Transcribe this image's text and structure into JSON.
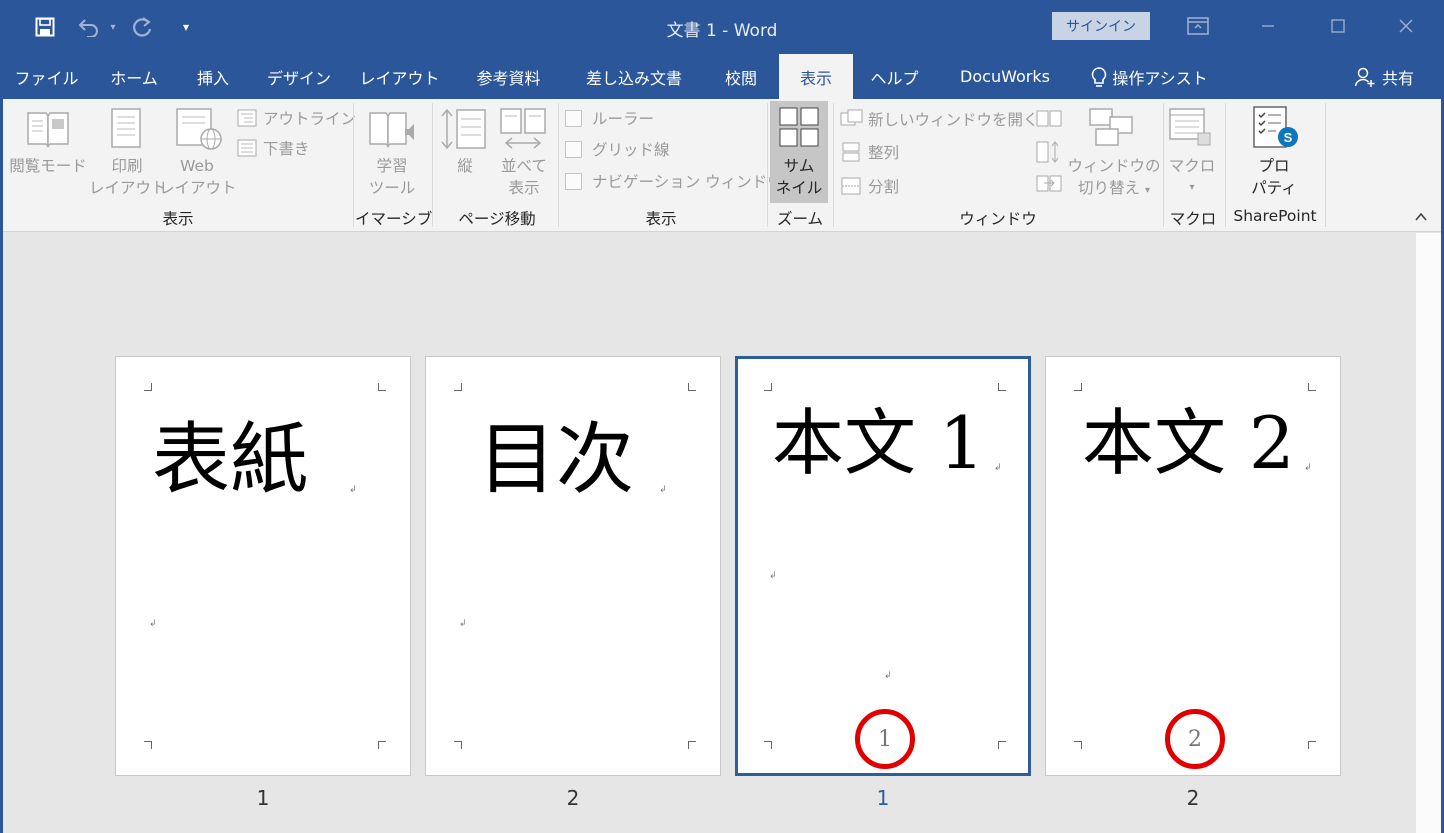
{
  "window": {
    "title": "文書 1 - Word",
    "signin": "サインイン",
    "share": "共有"
  },
  "tabs": [
    "ファイル",
    "ホーム",
    "挿入",
    "デザイン",
    "レイアウト",
    "参考資料",
    "差し込み文書",
    "校閲",
    "表示",
    "ヘルプ",
    "DocuWorks",
    "操作アシスト"
  ],
  "active_tab": "表示",
  "ribbon": {
    "views": {
      "read_mode": "閲覧モード",
      "print_layout_1": "印刷",
      "print_layout_2": "レイアウト",
      "web_layout_1": "Web",
      "web_layout_2": "レイアウト",
      "outline": "アウトライン",
      "draft": "下書き",
      "group": "表示"
    },
    "immersive": {
      "learning_tools_1": "学習",
      "learning_tools_2": "ツール",
      "group": "イマーシブ"
    },
    "page_movement": {
      "vertical": "縦",
      "side_1": "並べて",
      "side_2": "表示",
      "group": "ページ移動"
    },
    "show": {
      "ruler": "ルーラー",
      "gridlines": "グリッド線",
      "navigation": "ナビゲーション ウィンドウ",
      "group": "表示"
    },
    "zoom": {
      "thumbnails_1": "サム",
      "thumbnails_2": "ネイル",
      "group": "ズーム"
    },
    "window": {
      "new_window": "新しいウィンドウを開く",
      "arrange": "整列",
      "split": "分割",
      "switch_1": "ウィンドウの",
      "switch_2": "切り替え",
      "group": "ウィンドウ"
    },
    "macros": {
      "macros": "マクロ",
      "group": "マクロ"
    },
    "sharepoint": {
      "properties_1": "プロ",
      "properties_2": "パティ",
      "group": "SharePoint"
    }
  },
  "pages": [
    {
      "heading": "表紙",
      "footer": "",
      "label": "1"
    },
    {
      "heading": "目次",
      "footer": "",
      "label": "2"
    },
    {
      "heading": "本文 1",
      "footer": "1",
      "label": "1"
    },
    {
      "heading": "本文 2",
      "footer": "2",
      "label": "2"
    }
  ],
  "colors": {
    "accent": "#2b579a",
    "highlight_ring": "#e00000",
    "selected_page_border": "#2b5e9a"
  }
}
